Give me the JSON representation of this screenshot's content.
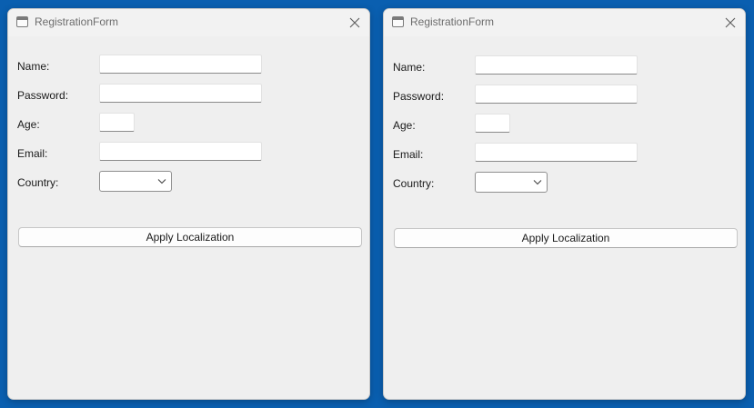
{
  "windows": [
    {
      "title": "RegistrationForm",
      "fields": {
        "name": {
          "label": "Name:",
          "value": ""
        },
        "password": {
          "label": "Password:",
          "value": ""
        },
        "age": {
          "label": "Age:",
          "value": ""
        },
        "email": {
          "label": "Email:",
          "value": ""
        },
        "country": {
          "label": "Country:",
          "selected": ""
        }
      },
      "apply_button": "Apply Localization"
    },
    {
      "title": "RegistrationForm",
      "fields": {
        "name": {
          "label": "Name:",
          "value": ""
        },
        "password": {
          "label": "Password:",
          "value": ""
        },
        "age": {
          "label": "Age:",
          "value": ""
        },
        "email": {
          "label": "Email:",
          "value": ""
        },
        "country": {
          "label": "Country:",
          "selected": ""
        }
      },
      "apply_button": "Apply Localization"
    }
  ],
  "icons": {
    "app": "window-icon",
    "close": "close-icon",
    "dropdown": "chevron-down-icon"
  },
  "colors": {
    "desktop": "#0a5fb0",
    "window_bg": "#efefef",
    "title_text": "#6d6d6d"
  }
}
